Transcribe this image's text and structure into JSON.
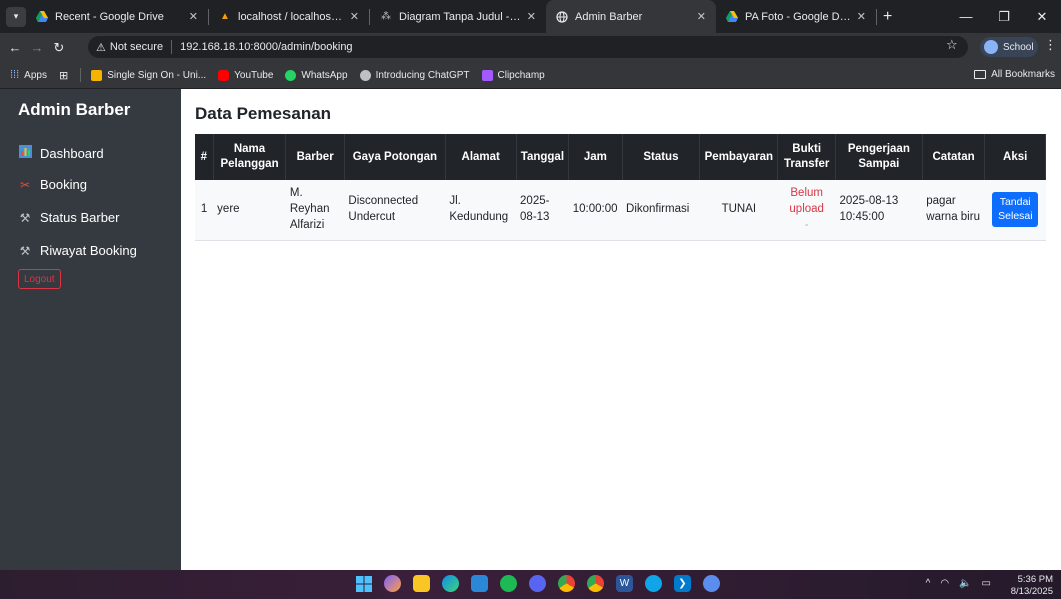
{
  "browser": {
    "tabs": [
      {
        "title": "Recent - Google Drive",
        "active": false
      },
      {
        "title": "localhost / localhost / barber / ",
        "active": false
      },
      {
        "title": "Diagram Tanpa Judul - draw.io",
        "active": false
      },
      {
        "title": "Admin Barber",
        "active": true
      },
      {
        "title": "PA Foto - Google Drive",
        "active": false
      }
    ],
    "security_label": "Not secure",
    "url": "192.168.18.10:8000/admin/booking",
    "profile_label": "School",
    "bookmarks": [
      {
        "label": "Apps",
        "color": "#8ab4f8"
      },
      {
        "label": "",
        "color": "#8ab4f8"
      },
      {
        "label": "Single Sign On - Uni...",
        "color": "#f4b400"
      },
      {
        "label": "YouTube",
        "color": "#ff0000"
      },
      {
        "label": "WhatsApp",
        "color": "#25d366"
      },
      {
        "label": "Introducing ChatGPT",
        "color": "#bdc1c6"
      },
      {
        "label": "Clipchamp",
        "color": "#a259ff"
      }
    ],
    "all_bookmarks": "All Bookmarks"
  },
  "sidebar": {
    "brand": "Admin Barber",
    "items": [
      {
        "label": "Dashboard",
        "icon": "chart-icon"
      },
      {
        "label": "Booking",
        "icon": "scissors-icon"
      },
      {
        "label": "Status Barber",
        "icon": "tools-icon"
      },
      {
        "label": "Riwayat Booking",
        "icon": "tools-icon"
      }
    ],
    "logout": "Logout"
  },
  "main": {
    "title": "Data Pemesanan",
    "columns": [
      "#",
      "Nama Pelanggan",
      "Barber",
      "Gaya Potongan",
      "Alamat",
      "Tanggal",
      "Jam",
      "Status",
      "Pembayaran",
      "Bukti Transfer",
      "Pengerjaan Sampai",
      "Catatan",
      "Aksi"
    ],
    "rows": [
      {
        "no": "1",
        "nama": "yere",
        "barber": "M. Reyhan Alfarizi",
        "gaya": "Disconnected Undercut",
        "alamat": "Jl. Kedundung",
        "tanggal": "2025-08-13",
        "jam": "10:00:00",
        "status": "Dikonfirmasi",
        "pembayaran": "TUNAI",
        "bukti": "Belum upload",
        "bukti_sub": "-",
        "pengerjaan": "2025-08-13 10:45:00",
        "catatan": "pagar warna biru",
        "aksi": "Tandai Selesai"
      }
    ]
  },
  "taskbar": {
    "time": "5:36 PM",
    "date": "8/13/2025"
  }
}
